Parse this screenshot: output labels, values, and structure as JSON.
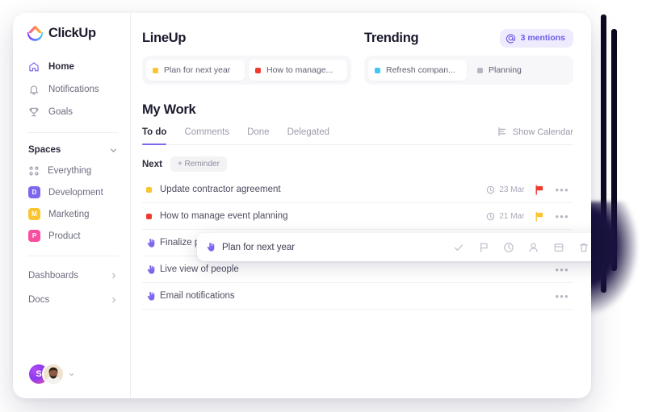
{
  "brand": {
    "name": "ClickUp",
    "logo_icon": "clickup-logo-icon"
  },
  "sidebar": {
    "nav": [
      {
        "label": "Home",
        "icon": "home-icon",
        "active": true
      },
      {
        "label": "Notifications",
        "icon": "bell-icon",
        "active": false
      },
      {
        "label": "Goals",
        "icon": "trophy-icon",
        "active": false
      }
    ],
    "spaces_header": {
      "label": "Spaces",
      "icon": "chevron-down-icon"
    },
    "spaces": [
      {
        "label": "Everything",
        "badge": "",
        "color": "",
        "icon": "grid-icon"
      },
      {
        "label": "Development",
        "badge": "D",
        "color": "#7b68ee"
      },
      {
        "label": "Marketing",
        "badge": "M",
        "color": "#fbc531"
      },
      {
        "label": "Product",
        "badge": "P",
        "color": "#fa4fa0"
      }
    ],
    "drilldowns": [
      {
        "label": "Dashboards",
        "icon": "chevron-right-icon"
      },
      {
        "label": "Docs",
        "icon": "chevron-right-icon"
      }
    ],
    "footer": {
      "avatar_initial": "S",
      "avatar_name": "avatar",
      "caret_icon": "chevron-down-icon"
    }
  },
  "lineup": {
    "title": "LineUp",
    "chips": [
      {
        "label": "Plan for next year",
        "color": "#fbc531",
        "style": "card"
      },
      {
        "label": "How to manage...",
        "color": "#ee3b2f",
        "style": "card"
      }
    ]
  },
  "trending": {
    "title": "Trending",
    "mentions_badge": {
      "label": "3 mentions",
      "icon": "at-icon",
      "accent": "#6b5ce7",
      "bg": "#eeebfe"
    },
    "chips": [
      {
        "label": "Refresh compan...",
        "color": "#3dc7f4",
        "style": "card"
      },
      {
        "label": "Planning",
        "color": "#b6b7c4",
        "style": "plain"
      }
    ]
  },
  "mywork": {
    "title": "My Work",
    "tabs": [
      {
        "label": "To do",
        "active": true
      },
      {
        "label": "Comments",
        "active": false
      },
      {
        "label": "Done",
        "active": false
      },
      {
        "label": "Delegated",
        "active": false
      }
    ],
    "active_accent": "#7b68ee",
    "show_calendar": {
      "label": "Show Calendar",
      "icon": "calendar-icon"
    },
    "group": {
      "label": "Next",
      "add_reminder_label": "+ Reminder"
    },
    "tasks": [
      {
        "name": "Update contractor agreement",
        "lead_icon": "status-dot",
        "lead_color": "#fbc531",
        "due": "23 Mar",
        "due_icon": "clock-icon",
        "flag_icon": "flag-icon",
        "flag_color": "#ee3b2f",
        "menu_icon": "more-icon",
        "menu_label": "•••"
      },
      {
        "name": "How to manage event planning",
        "lead_icon": "status-dot",
        "lead_color": "#ee3b2f",
        "due": "21 Mar",
        "due_icon": "clock-icon",
        "flag_icon": "flag-icon",
        "flag_color": "#fbc531",
        "menu_icon": "more-icon",
        "menu_label": "•••"
      },
      {
        "name": "Finalize project scope",
        "lead_icon": "reminder-hand-icon",
        "lead_color": "#7b68ee",
        "due": "",
        "flag_icon": "",
        "flag_color": "",
        "menu_icon": "more-icon",
        "menu_label": "•••"
      },
      {
        "name": "Live view of people",
        "lead_icon": "reminder-hand-icon",
        "lead_color": "#7b68ee",
        "due": "",
        "flag_icon": "",
        "flag_color": "",
        "menu_icon": "more-icon",
        "menu_label": "•••"
      },
      {
        "name": "Email notifications",
        "lead_icon": "reminder-hand-icon",
        "lead_color": "#7b68ee",
        "due": "",
        "flag_icon": "",
        "flag_color": "",
        "menu_icon": "more-icon",
        "menu_label": "•••"
      }
    ]
  },
  "float_card": {
    "name": "Plan for next year",
    "lead_icon": "reminder-hand-icon",
    "actions": [
      {
        "icon": "check-icon",
        "accent": false
      },
      {
        "icon": "flag-icon",
        "accent": false
      },
      {
        "icon": "clock-icon",
        "accent": false
      },
      {
        "icon": "assign-user-icon",
        "accent": false
      },
      {
        "icon": "calendar-icon",
        "accent": false
      },
      {
        "icon": "trash-icon",
        "accent": false
      },
      {
        "icon": "bell-icon",
        "accent": true
      }
    ]
  }
}
